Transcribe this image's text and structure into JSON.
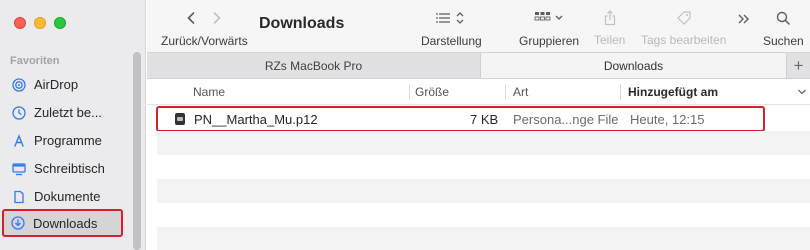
{
  "sidebar": {
    "section": "Favoriten",
    "items": [
      {
        "label": "AirDrop",
        "icon": "airdrop-icon"
      },
      {
        "label": "Zuletzt be...",
        "icon": "clock-icon"
      },
      {
        "label": "Programme",
        "icon": "apps-icon"
      },
      {
        "label": "Schreibtisch",
        "icon": "desktop-icon"
      },
      {
        "label": "Dokumente",
        "icon": "document-icon"
      },
      {
        "label": "Downloads",
        "icon": "download-icon"
      }
    ]
  },
  "toolbar": {
    "nav_label": "Zurück/Vorwärts",
    "title": "Downloads",
    "view_label": "Darstellung",
    "group_label": "Gruppieren",
    "share_label": "Teilen",
    "tags_label": "Tags bearbeiten",
    "search_label": "Suchen"
  },
  "tabs": [
    {
      "label": "RZs MacBook Pro"
    },
    {
      "label": "Downloads"
    }
  ],
  "columns": {
    "name": "Name",
    "size": "Größe",
    "kind": "Art",
    "date": "Hinzugefügt am"
  },
  "files": [
    {
      "name": "PN__Martha_Mu.p12",
      "size": "7 KB",
      "kind": "Persona...nge File",
      "date": "Heute, 12:15"
    }
  ],
  "colors": {
    "accent": "#2f7bf5",
    "highlight": "#d2232a"
  }
}
